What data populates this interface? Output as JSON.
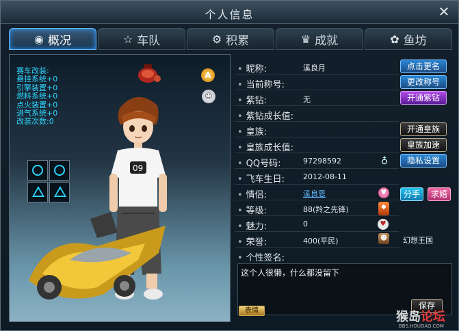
{
  "window": {
    "title": "个人信息",
    "close": "✕"
  },
  "tabs": [
    {
      "icon": "◉",
      "label": "概况"
    },
    {
      "icon": "☆",
      "label": "车队"
    },
    {
      "icon": "⚙",
      "label": "积累"
    },
    {
      "icon": "♛",
      "label": "成就"
    },
    {
      "icon": "✿",
      "label": "鱼坊"
    }
  ],
  "kart_stats": [
    "赛车改装:",
    "悬挂系统+0",
    "引擎装置+0",
    "燃料系统+0",
    "点火装置+0",
    "进气系统+0",
    "改装次数:0"
  ],
  "badges": {
    "a": "A",
    "chat": "☺"
  },
  "profile": {
    "nickname_label": "昵称:",
    "nickname": "溪良月",
    "title_label": "当前称号:",
    "purple_label": "紫钻:",
    "purple": "无",
    "purple_growth_label": "紫钻成长值:",
    "royal_label": "皇族:",
    "royal_growth_label": "皇族成长值:",
    "qq_label": "QQ号码:",
    "qq": "97298592",
    "birthday_label": "飞车生日:",
    "birthday": "2012-08-11",
    "lover_label": "情侣:",
    "lover": "溪良恩",
    "level_label": "等级:",
    "level": "88(羚之先锋)",
    "charm_label": "魅力:",
    "charm": "0",
    "honor_label": "荣誉:",
    "honor": "400(平民)",
    "kingdom": "幻想王国",
    "signature_label": "个性签名:",
    "signature": "这个人很懒，什么都没留下"
  },
  "buttons": {
    "rename": "点击更名",
    "change_title": "更改称号",
    "open_purple": "开通紫钻",
    "open_royal": "开通皇族",
    "royal_speed": "皇族加速",
    "privacy": "隐私设置",
    "breakup": "分手",
    "propose": "求婚",
    "save": "保存",
    "expression": "表情"
  },
  "watermark": {
    "main1": "猴岛",
    "main2": "论坛",
    "sub": "BBS.HOUDAO.COM"
  }
}
